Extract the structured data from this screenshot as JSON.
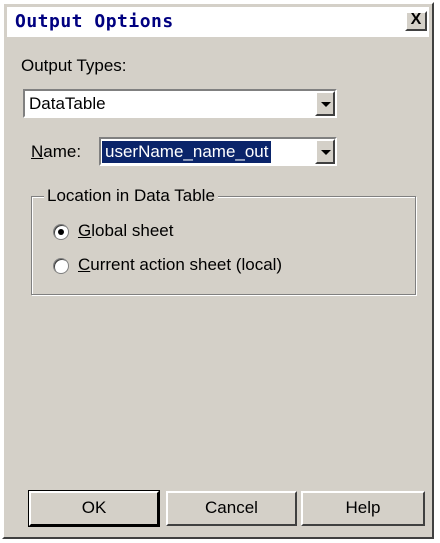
{
  "window": {
    "title": "Output Options",
    "close_label": "X"
  },
  "output_types": {
    "label": "Output Types:",
    "selected": "DataTable"
  },
  "name": {
    "label_accel": "N",
    "label_rest": "ame:",
    "value": "userName_name_out"
  },
  "location": {
    "legend": "Location in Data Table",
    "options": [
      {
        "accel": "G",
        "rest": "lobal sheet",
        "checked": true
      },
      {
        "accel": "C",
        "rest": "urrent action sheet (local)",
        "checked": false
      }
    ]
  },
  "buttons": {
    "ok": "OK",
    "cancel": "Cancel",
    "help": "Help"
  }
}
